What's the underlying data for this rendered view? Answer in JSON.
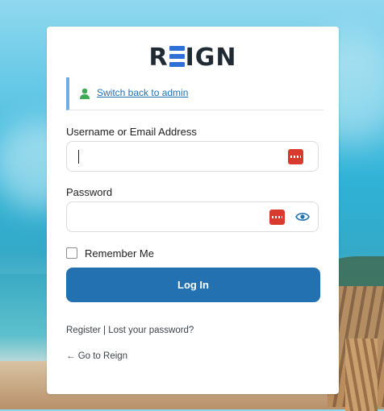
{
  "logo": {
    "prefix": "R",
    "suffix": "IGN",
    "accent_color": "#2f6fd8",
    "text_color": "#1f2a33"
  },
  "notice": {
    "switch_link": "Switch back to admin",
    "icon": "user-icon"
  },
  "form": {
    "username_label": "Username or Email Address",
    "username_value": "",
    "password_label": "Password",
    "password_value": "",
    "remember_label": "Remember Me",
    "remember_checked": false,
    "submit_label": "Log In"
  },
  "footer": {
    "register_link": "Register",
    "separator": " | ",
    "lost_password_link": "Lost your password?",
    "back_link": "← Go to Reign"
  },
  "colors": {
    "button": "#2371b1",
    "link": "#2271b1",
    "notice_border": "#72aee6",
    "password_manager": "#d93a2e"
  }
}
